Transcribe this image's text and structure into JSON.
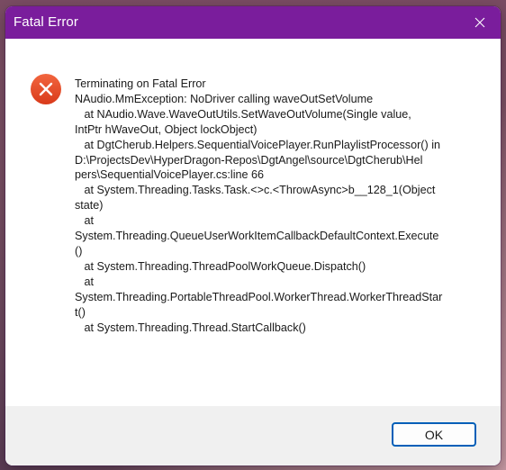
{
  "window": {
    "title": "Fatal Error"
  },
  "titlebar": {
    "close_icon": "close-icon"
  },
  "message": {
    "icon": "error-icon",
    "lines": [
      "Terminating on Fatal Error",
      "NAudio.MmException: NoDriver calling waveOutSetVolume",
      "   at NAudio.Wave.WaveOutUtils.SetWaveOutVolume(Single value,",
      "IntPtr hWaveOut, Object lockObject)",
      "   at DgtCherub.Helpers.SequentialVoicePlayer.RunPlaylistProcessor() in",
      "D:\\ProjectsDev\\HyperDragon-Repos\\DgtAngel\\source\\DgtCherub\\Hel",
      "pers\\SequentialVoicePlayer.cs:line 66",
      "   at System.Threading.Tasks.Task.<>c.<ThrowAsync>b__128_1(Object",
      "state)",
      "   at",
      "System.Threading.QueueUserWorkItemCallbackDefaultContext.Execute",
      "()",
      "   at System.Threading.ThreadPoolWorkQueue.Dispatch()",
      "   at",
      "System.Threading.PortableThreadPool.WorkerThread.WorkerThreadStar",
      "t()",
      "   at System.Threading.Thread.StartCallback()"
    ]
  },
  "footer": {
    "ok_label": "OK"
  },
  "colors": {
    "titlebar": "#7a1d9c",
    "error_icon": "#e2401c",
    "button_border": "#005fb8",
    "footer_bg": "#f0f0f0"
  }
}
